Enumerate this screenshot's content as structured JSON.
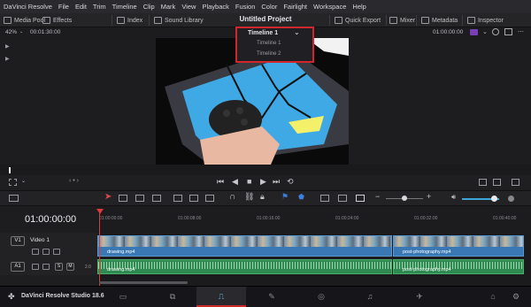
{
  "menu": [
    "DaVinci Resolve",
    "File",
    "Edit",
    "Trim",
    "Timeline",
    "Clip",
    "Mark",
    "View",
    "Playback",
    "Fusion",
    "Color",
    "Fairlight",
    "Workspace",
    "Help"
  ],
  "toolbar": {
    "media_pool": "Media Pool",
    "effects": "Effects",
    "index": "Index",
    "sound_library": "Sound Library",
    "project_title": "Untitled Project",
    "quick_export": "Quick Export",
    "mixer": "Mixer",
    "metadata": "Metadata",
    "inspector": "Inspector"
  },
  "viewer": {
    "zoom": "42%",
    "timecode_left": "00:01:30:00",
    "timeline_selected": "Timeline 1",
    "timecode_right": "01:00:00:00",
    "timeline_options": [
      "Timeline 1",
      "Timeline 2"
    ]
  },
  "timeline": {
    "current_timecode": "01:00:00:00",
    "ruler_ticks": [
      "01:00:00:00",
      "01:00:08:00",
      "01:00:16:00",
      "01:00:24:00",
      "01:00:32:00",
      "01:00:40:00"
    ],
    "tracks": {
      "video": {
        "id": "V1",
        "name": "Video 1"
      },
      "audio": {
        "id": "A1",
        "level": "2.0"
      }
    },
    "clips": {
      "video_1": "drawing.mp4",
      "video_2": "post-photography.mp4",
      "audio_1": "drawing.mp4",
      "audio_2": "post-photography.mp4"
    }
  },
  "footer": {
    "app_name": "DaVinci Resolve Studio 18.6"
  },
  "colors": {
    "highlight": "#d0262c",
    "video_clip": "#3a78b5",
    "audio_clip": "#2f8a52",
    "playhead": "#e03a3a"
  }
}
